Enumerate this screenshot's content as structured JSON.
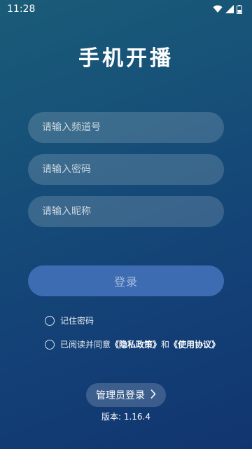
{
  "status_bar": {
    "time": "11:28"
  },
  "title": "手机开播",
  "form": {
    "channel_placeholder": "请输入频道号",
    "password_placeholder": "请输入密码",
    "nickname_placeholder": "请输入昵称",
    "login_label": "登录"
  },
  "options": {
    "remember_label": "记住密码",
    "agree_prefix": "已阅读并同意",
    "privacy_link": "《隐私政策》",
    "and_text": "和",
    "terms_link": "《使用协议》"
  },
  "admin": {
    "label": "管理员登录"
  },
  "version": "版本: 1.16.4",
  "colors": {
    "background_top": "#1a5c78",
    "background_bottom": "#113570",
    "login_button": "#3d6cb3"
  },
  "icons": [
    "wifi-icon",
    "signal-icon",
    "battery-icon",
    "chevron-right-icon"
  ]
}
